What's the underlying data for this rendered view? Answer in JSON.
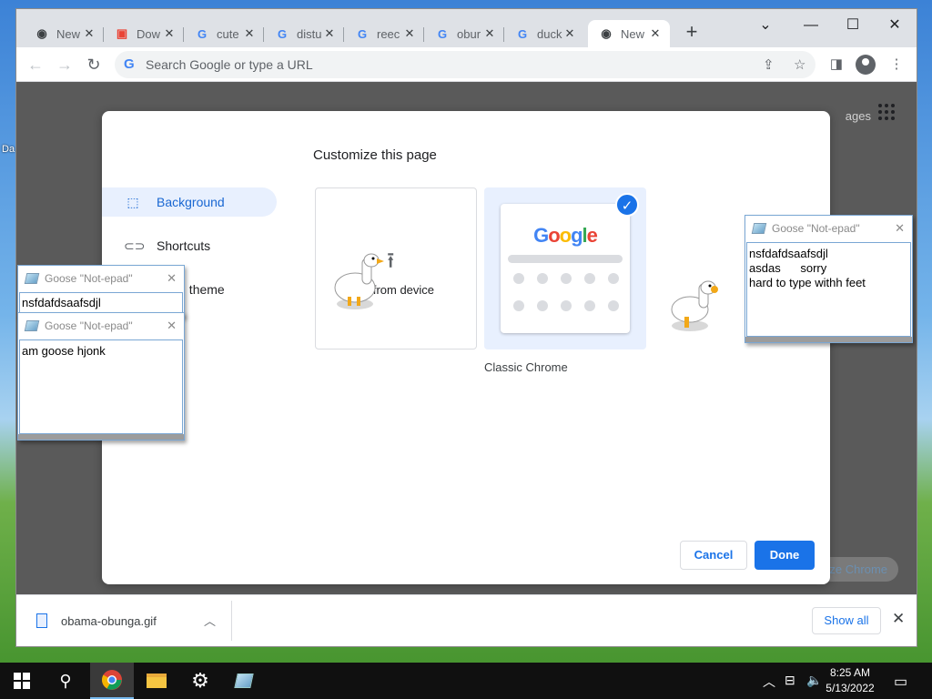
{
  "desktop": {
    "edge_label": "Da"
  },
  "tabs": [
    {
      "label": "New",
      "icon": "chrome-icon"
    },
    {
      "label": "Dow",
      "icon": "store-icon"
    },
    {
      "label": "cute",
      "icon": "google-icon"
    },
    {
      "label": "distu",
      "icon": "google-icon"
    },
    {
      "label": "reec",
      "icon": "google-icon"
    },
    {
      "label": "obur",
      "icon": "google-icon"
    },
    {
      "label": "duck",
      "icon": "google-icon"
    },
    {
      "label": "New",
      "icon": "chrome-icon"
    }
  ],
  "omnibox": {
    "placeholder": "Search Google or type a URL"
  },
  "page_behind": {
    "right_text": "ages",
    "customize_button": "ze Chrome"
  },
  "dialog": {
    "title": "Customize this page",
    "sidebar": [
      {
        "label": "Background",
        "icon": "image-icon",
        "active": true
      },
      {
        "label": "Shortcuts",
        "icon": "link-icon",
        "active": false
      },
      {
        "label": "r and theme",
        "icon": "palette-icon",
        "active": false
      }
    ],
    "tiles": {
      "upload_label": "d from device",
      "classic_caption": "Classic Chrome",
      "classic_logo": [
        "G",
        "o",
        "o",
        "g",
        "l",
        "e"
      ]
    },
    "buttons": {
      "cancel": "Cancel",
      "done": "Done"
    }
  },
  "downloads": {
    "file_name": "obama-obunga.gif",
    "show_all": "Show all"
  },
  "notepads": [
    {
      "title": "Goose \"Not-epad\"",
      "text": "nsfdafdsaafsdjl"
    },
    {
      "title": "Goose \"Not-epad\"",
      "text": "am goose hjonk"
    },
    {
      "title": "Goose \"Not-epad\"",
      "text": "nsfdafdsaafsdjl\nasdas      sorry\nhard to type withh feet"
    }
  ],
  "taskbar": {
    "time": "8:25 AM",
    "date": "5/13/2022"
  },
  "colors": {
    "accent": "#1a73e8",
    "tab_bar": "#dee1e6",
    "taskbar": "#101010"
  }
}
